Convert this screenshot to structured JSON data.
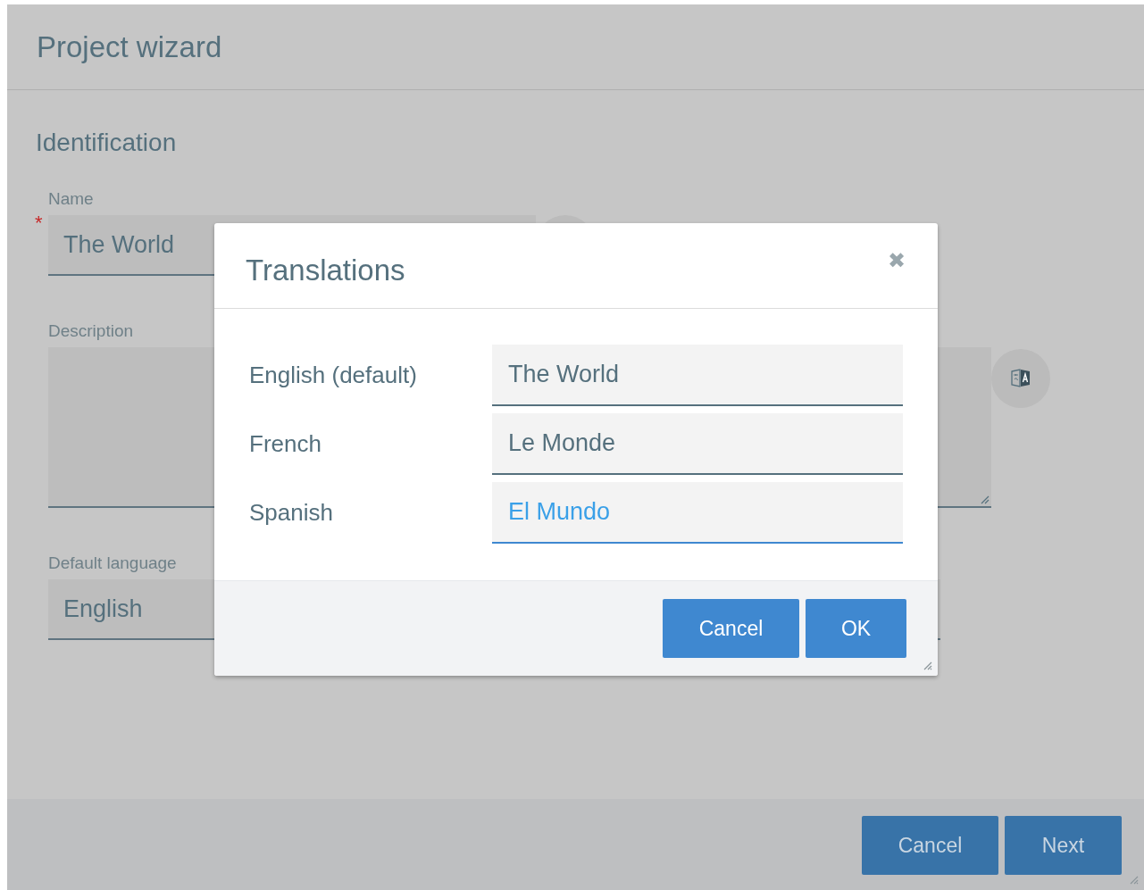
{
  "window": {
    "title": "Project wizard"
  },
  "section": {
    "title": "Identification"
  },
  "fields": [
    {
      "kind": "text",
      "label": "Name",
      "value": "The World",
      "required_mark": "*",
      "translatable": true
    },
    {
      "kind": "textarea",
      "label": "Description",
      "translatable": true
    },
    {
      "kind": "select",
      "label": "Default language",
      "value": "English",
      "translatable": false
    }
  ],
  "footer": {
    "buttons": [
      "Cancel",
      "Next"
    ]
  },
  "dialog": {
    "title": "Translations",
    "close": "✖",
    "rows": [
      {
        "label": "English (default)",
        "value": "The World",
        "focused": false
      },
      {
        "label": "French",
        "value": "Le Monde",
        "focused": false
      },
      {
        "label": "Spanish",
        "value": "El Mundo",
        "focused": true
      }
    ],
    "buttons": [
      "Cancel",
      "OK"
    ]
  }
}
